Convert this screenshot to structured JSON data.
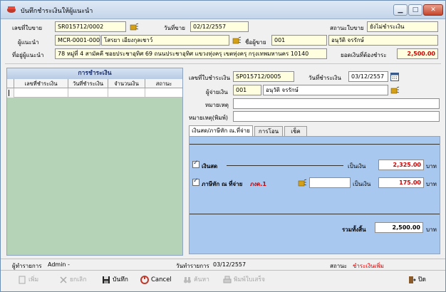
{
  "window": {
    "title": "บันทึกชำระเงินให้ผู้แนะนำ"
  },
  "header": {
    "sale_no_label": "เลขที่ใบขาย",
    "sale_no": "SR015712/0002",
    "sale_date_label": "วันที่ขาย",
    "sale_date": "02/12/2557",
    "bill_status_label": "สถานะใบขาย",
    "bill_status": "ยังไม่ชำระเงิน",
    "referrer_label": "ผู้แนะนำ",
    "referrer_code": "MCR-0001-00001",
    "referrer_name": "โสรยา เอียงกุลเชาว์",
    "seller_label": "ชื่อผู้ขาย",
    "seller_code": "001",
    "seller_name": "อนุวัติ จรรักษ์",
    "address_label": "ที่อยู่ผู้แนะนำ",
    "address": "78 หมู่ที่ 4 สามัคคี ซอยประชาอุทิศ 69 ถนนประชาอุทิศ แขวงทุ่งครุ เขตทุ่งครุ กรุงเทพมหานคร 10140",
    "balance_label": "ยอดเงินที่ต้องชำระ",
    "balance": "2,500.00"
  },
  "payments": {
    "title": "การชำระเงิน",
    "columns": [
      "เลขที่ชำระเงิน",
      "วันที่ชำระเงิน",
      "จำนวนเงิน",
      "สถานะ"
    ]
  },
  "detail": {
    "pay_no_label": "เลขที่ใบชำระเงิน",
    "pay_no": "SP015712/0005",
    "pay_date_label": "วันที่ชำระเงิน",
    "pay_date": "03/12/2557",
    "payer_label": "ผู้จ่ายเงิน",
    "payer_code": "001",
    "payer_name": "อนุวัติ จรรักษ์",
    "note_label": "หมายเหตุ",
    "note": "",
    "print_note_label": "หมายเหตุ(พิมพ์)",
    "print_note": ""
  },
  "tabs": [
    "เงินสด/ภาษีหัก ณ.ที่จ่าย",
    "การโอน",
    "เช็ค"
  ],
  "cash": {
    "cash_label": "เงินสด",
    "amount_label": "เป็นเงิน",
    "cash_amount": "2,325.00",
    "unit": "บาท",
    "wht_label": "ภาษีหัก ณ ที่จ่าย",
    "wht_code": "ภงด.1",
    "wht_amount": "175.00",
    "total_label": "รวมทั้งสิ้น",
    "total_amount": "2,500.00"
  },
  "status": {
    "operator_label": "ผู้ทำรายการ",
    "operator": "Admin -",
    "txn_date_label": "วันทำรายการ",
    "txn_date": "03/12/2557",
    "status_label": "สถานะ",
    "status_value": "ชำระเงินเพิ่ม"
  },
  "toolbar": {
    "add": "เพิ่ม",
    "cancel_doc": "ยกเลิก",
    "save": "บันทึก",
    "cancel": "Cancel",
    "search": "ค้นหา",
    "print": "พิมพ์ใบเสร็จ",
    "close": "ปิด"
  }
}
